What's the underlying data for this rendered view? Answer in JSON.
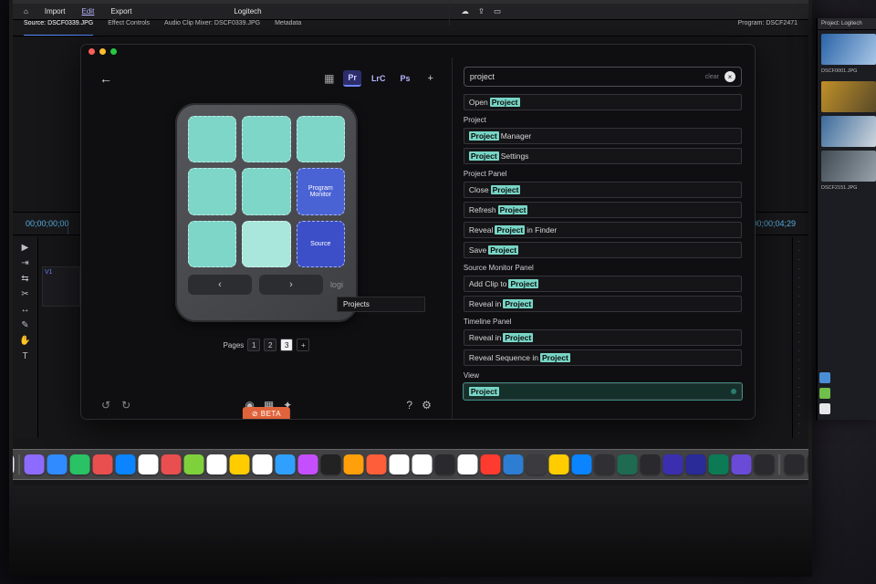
{
  "menubar": {
    "apple": "",
    "title_center": "Logitech"
  },
  "toolbar": {
    "home_icon": "⌂",
    "items": [
      "Import",
      "Edit",
      "Export"
    ],
    "right": {
      "cloud": "☁",
      "share": "⇪",
      "workspace": "▭"
    }
  },
  "panelrow": {
    "items": [
      "Source: DSCF0339.JPG",
      "Effect Controls",
      "Audio Clip Mixer: DSCF0339.JPG",
      "Metadata"
    ],
    "program": "Program: DSCF2471"
  },
  "timeline": {
    "left_tc": "00;00;00;00",
    "right_tc": "00;00;04;29"
  },
  "tracks": {
    "v1": "V1"
  },
  "logi": {
    "back": "←",
    "apps": [
      {
        "label": "Pr",
        "active": true
      },
      {
        "label": "LrC",
        "active": false
      },
      {
        "label": "Ps",
        "active": false
      }
    ],
    "plus": "+",
    "keys": [
      {
        "cls": "teal",
        "label": ""
      },
      {
        "cls": "teal",
        "label": ""
      },
      {
        "cls": "teal",
        "label": ""
      },
      {
        "cls": "teal",
        "label": ""
      },
      {
        "cls": "teal",
        "label": ""
      },
      {
        "cls": "blue",
        "label": "Program Monitor"
      },
      {
        "cls": "teal",
        "label": ""
      },
      {
        "cls": "tealL",
        "label": ""
      },
      {
        "cls": "blueD",
        "label": "Source"
      }
    ],
    "tooltip": "Projects",
    "nav": {
      "prev": "‹",
      "next": "›",
      "brand": "logi"
    },
    "pages": {
      "label": "Pages",
      "list": [
        "1",
        "2",
        "3"
      ],
      "current": 2,
      "add": "+"
    },
    "bottom": {
      "undo": "↺",
      "redo": "↻",
      "dial": "◉",
      "grid": "▦",
      "sparkle": "✦",
      "help": "?",
      "gear": "⚙"
    },
    "beta": "⊘ BETA"
  },
  "search": {
    "value": "project",
    "clear": "clear",
    "x": "×"
  },
  "cmds": [
    {
      "type": "cmd",
      "pre": "Open ",
      "hl": "Project",
      "post": ""
    },
    {
      "type": "group",
      "label": "Project"
    },
    {
      "type": "cmd",
      "pre": "",
      "hl": "Project",
      "post": " Manager"
    },
    {
      "type": "cmd",
      "pre": "",
      "hl": "Project",
      "post": " Settings"
    },
    {
      "type": "group",
      "label": "Project Panel"
    },
    {
      "type": "cmd",
      "pre": "Close ",
      "hl": "Project",
      "post": ""
    },
    {
      "type": "cmd",
      "pre": "Refresh ",
      "hl": "Project",
      "post": ""
    },
    {
      "type": "cmd",
      "pre": "Reveal ",
      "hl": "Project",
      "post": " in Finder"
    },
    {
      "type": "cmd",
      "pre": "Save ",
      "hl": "Project",
      "post": ""
    },
    {
      "type": "group",
      "label": "Source Monitor Panel"
    },
    {
      "type": "cmd",
      "pre": "Add Clip to ",
      "hl": "Project",
      "post": ""
    },
    {
      "type": "cmd",
      "pre": "Reveal in ",
      "hl": "Project",
      "post": ""
    },
    {
      "type": "group",
      "label": "Timeline Panel"
    },
    {
      "type": "cmd",
      "pre": "Reveal in ",
      "hl": "Project",
      "post": ""
    },
    {
      "type": "cmd",
      "pre": "Reveal Sequence in ",
      "hl": "Project",
      "post": ""
    },
    {
      "type": "group",
      "label": "View"
    },
    {
      "type": "cmd",
      "pre": "",
      "hl": "Project",
      "post": "",
      "picked": true
    }
  ],
  "dock_colors": [
    "#e8e8ef",
    "#8e6bff",
    "#2f8bff",
    "#29c265",
    "#e94f4f",
    "#0a84ff",
    "#ffffff",
    "#e94f4f",
    "#7fd13b",
    "#ffffff",
    "#ffcc00",
    "#ffffff",
    "#30a0ff",
    "#c54fff",
    "#222222",
    "#ff9f0a",
    "#ff5e3a",
    "#ffffff",
    "#ffffff",
    "#2a2a2e",
    "#ffffff",
    "#ff3b30",
    "#2d7dd2",
    "#3a3a3f",
    "#ffcc00",
    "#0a84ff",
    "#2f2f34",
    "#1e6b52",
    "#2a2a2e",
    "#3b2fb0",
    "#2a2a99",
    "#0c7b55",
    "#6a4bd8",
    "#2a2a2e",
    "#2a2a2e",
    "#2a2a2e"
  ],
  "mon2": {
    "header": "Project: Logitech",
    "items": [
      {
        "cap": "DSCF0001.JPG",
        "bg": "linear-gradient(120deg,#2a64a8,#a8c6e6)"
      },
      {
        "cap": "",
        "bg": "linear-gradient(120deg,#c09028,#5a4a28)"
      },
      {
        "cap": "",
        "bg": "linear-gradient(120deg,#3a6a9a,#cfd6dd)"
      },
      {
        "cap": "DSCF2151.JPG",
        "bg": "linear-gradient(120deg,#404a52,#98a2aa)"
      }
    ]
  }
}
